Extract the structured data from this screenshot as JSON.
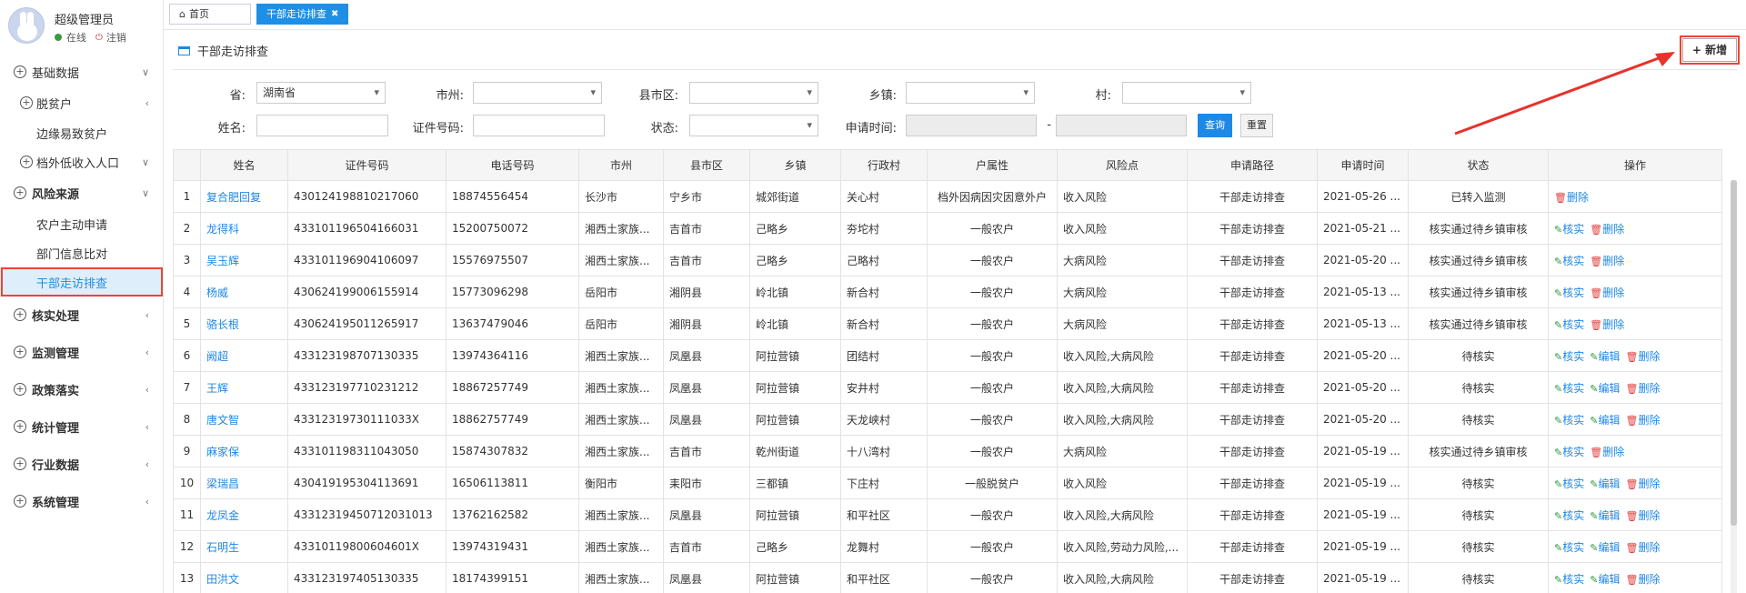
{
  "user": {
    "name": "超级管理员",
    "status": "在线",
    "logout": "注销"
  },
  "sidebar": [
    {
      "label": "基础数据",
      "type": "top",
      "arrow": "∨"
    },
    {
      "label": "脱贫户",
      "type": "sub",
      "arrow": "‹"
    },
    {
      "label": "边缘易致贫户",
      "type": "child"
    },
    {
      "label": "档外低收入人口",
      "type": "sub",
      "arrow": "∨"
    },
    {
      "label": "风险来源",
      "type": "top-bold",
      "arrow": "∨"
    },
    {
      "label": "农户主动申请",
      "type": "child"
    },
    {
      "label": "部门信息比对",
      "type": "child"
    },
    {
      "label": "干部走访排查",
      "type": "child-active"
    },
    {
      "label": "核实处理",
      "type": "top-bold",
      "arrow": "‹"
    },
    {
      "label": "监测管理",
      "type": "top-bold",
      "arrow": "‹"
    },
    {
      "label": "政策落实",
      "type": "top-bold",
      "arrow": "‹"
    },
    {
      "label": "统计管理",
      "type": "top-bold",
      "arrow": "‹"
    },
    {
      "label": "行业数据",
      "type": "top-bold",
      "arrow": "‹"
    },
    {
      "label": "系统管理",
      "type": "top-bold",
      "arrow": "‹"
    }
  ],
  "tabs": {
    "home": "首页",
    "active": "干部走访排查",
    "close": "✖"
  },
  "panel": {
    "title": "干部走访排查",
    "add": "+ 新增"
  },
  "filters": {
    "province_label": "省:",
    "province_value": "湖南省",
    "city_label": "市州:",
    "city_value": "",
    "county_label": "县市区:",
    "county_value": "",
    "town_label": "乡镇:",
    "town_value": "",
    "village_label": "村:",
    "village_value": "",
    "name_label": "姓名:",
    "name_value": "",
    "idno_label": "证件号码:",
    "idno_value": "",
    "status_label": "状态:",
    "status_value": "",
    "date_label": "申请时间:",
    "date_sep": "-",
    "query": "查询",
    "reset": "重置"
  },
  "table": {
    "columns": [
      "",
      "姓名",
      "证件号码",
      "电话号码",
      "市州",
      "县市区",
      "乡镇",
      "行政村",
      "户属性",
      "风险点",
      "申请路径",
      "申请时间",
      "状态",
      "操作"
    ],
    "rows": [
      {
        "n": "1",
        "name": "复合肥回复",
        "id": "430124198810217060",
        "phone": "18874556454",
        "city": "长沙市",
        "county": "宁乡市",
        "town": "城郊街道",
        "village": "关心村",
        "attr": "档外因病因灾因意外户",
        "risk": "收入风险",
        "path": "干部走访排查",
        "date": "2021-05-26 ...",
        "status": "已转入监测",
        "ops": [
          "del"
        ]
      },
      {
        "n": "2",
        "name": "龙得科",
        "id": "433101196504166031",
        "phone": "15200750072",
        "city": "湘西土家族...",
        "county": "吉首市",
        "town": "己略乡",
        "village": "夯坨村",
        "attr": "一般农户",
        "risk": "收入风险",
        "path": "干部走访排查",
        "date": "2021-05-21 ...",
        "status": "核实通过待乡镇审核",
        "ops": [
          "check",
          "del"
        ]
      },
      {
        "n": "3",
        "name": "吴玉辉",
        "id": "433101196904106097",
        "phone": "15576975507",
        "city": "湘西土家族...",
        "county": "吉首市",
        "town": "己略乡",
        "village": "己略村",
        "attr": "一般农户",
        "risk": "大病风险",
        "path": "干部走访排查",
        "date": "2021-05-20 ...",
        "status": "核实通过待乡镇审核",
        "ops": [
          "check",
          "del"
        ]
      },
      {
        "n": "4",
        "name": "杨威",
        "id": "430624199006155914",
        "phone": "15773096298",
        "city": "岳阳市",
        "county": "湘阴县",
        "town": "岭北镇",
        "village": "新合村",
        "attr": "一般农户",
        "risk": "大病风险",
        "path": "干部走访排查",
        "date": "2021-05-13 ...",
        "status": "核实通过待乡镇审核",
        "ops": [
          "check",
          "del"
        ]
      },
      {
        "n": "5",
        "name": "骆长根",
        "id": "430624195011265917",
        "phone": "13637479046",
        "city": "岳阳市",
        "county": "湘阴县",
        "town": "岭北镇",
        "village": "新合村",
        "attr": "一般农户",
        "risk": "大病风险",
        "path": "干部走访排查",
        "date": "2021-05-13 ...",
        "status": "核实通过待乡镇审核",
        "ops": [
          "check",
          "del"
        ]
      },
      {
        "n": "6",
        "name": "阙超",
        "id": "433123198707130335",
        "phone": "13974364116",
        "city": "湘西土家族...",
        "county": "凤凰县",
        "town": "阿拉营镇",
        "village": "团结村",
        "attr": "一般农户",
        "risk": "收入风险,大病风险",
        "path": "干部走访排查",
        "date": "2021-05-20 ...",
        "status": "待核实",
        "ops": [
          "check",
          "edit",
          "del"
        ]
      },
      {
        "n": "7",
        "name": "王辉",
        "id": "433123197710231212",
        "phone": "18867257749",
        "city": "湘西土家族...",
        "county": "凤凰县",
        "town": "阿拉营镇",
        "village": "安井村",
        "attr": "一般农户",
        "risk": "收入风险,大病风险",
        "path": "干部走访排查",
        "date": "2021-05-20 ...",
        "status": "待核实",
        "ops": [
          "check",
          "edit",
          "del"
        ]
      },
      {
        "n": "8",
        "name": "唐文智",
        "id": "43312319730111033X",
        "phone": "18862757749",
        "city": "湘西土家族...",
        "county": "凤凰县",
        "town": "阿拉营镇",
        "village": "天龙峡村",
        "attr": "一般农户",
        "risk": "收入风险,大病风险",
        "path": "干部走访排查",
        "date": "2021-05-20 ...",
        "status": "待核实",
        "ops": [
          "check",
          "edit",
          "del"
        ]
      },
      {
        "n": "9",
        "name": "麻家保",
        "id": "433101198311043050",
        "phone": "15874307832",
        "city": "湘西土家族...",
        "county": "吉首市",
        "town": "乾州街道",
        "village": "十八湾村",
        "attr": "一般农户",
        "risk": "大病风险",
        "path": "干部走访排查",
        "date": "2021-05-19 ...",
        "status": "核实通过待乡镇审核",
        "ops": [
          "check",
          "del"
        ]
      },
      {
        "n": "10",
        "name": "梁瑞昌",
        "id": "430419195304113691",
        "phone": "16506113811",
        "city": "衡阳市",
        "county": "耒阳市",
        "town": "三都镇",
        "village": "下庄村",
        "attr": "一般脱贫户",
        "risk": "收入风险",
        "path": "干部走访排查",
        "date": "2021-05-19 ...",
        "status": "待核实",
        "ops": [
          "check",
          "edit",
          "del"
        ]
      },
      {
        "n": "11",
        "name": "龙凤金",
        "id": "433123194507120310​13",
        "phone": "13762162582",
        "city": "湘西土家族...",
        "county": "凤凰县",
        "town": "阿拉营镇",
        "village": "和平社区",
        "attr": "一般农户",
        "risk": "收入风险,大病风险",
        "path": "干部走访排查",
        "date": "2021-05-19 ...",
        "status": "待核实",
        "ops": [
          "check",
          "edit",
          "del"
        ]
      },
      {
        "n": "12",
        "name": "石明生",
        "id": "43310119800604601X",
        "phone": "13974319431",
        "city": "湘西土家族...",
        "county": "吉首市",
        "town": "己略乡",
        "village": "龙舞村",
        "attr": "一般农户",
        "risk": "收入风险,劳动力风险,...",
        "path": "干部走访排查",
        "date": "2021-05-19 ...",
        "status": "待核实",
        "ops": [
          "check",
          "edit",
          "del"
        ]
      },
      {
        "n": "13",
        "name": "田洪文",
        "id": "433123197405130335",
        "phone": "18174399151",
        "city": "湘西土家族...",
        "county": "凤凰县",
        "town": "阿拉营镇",
        "village": "和平社区",
        "attr": "一般农户",
        "risk": "收入风险,大病风险",
        "path": "干部走访排查",
        "date": "2021-05-19 ...",
        "status": "待核实",
        "ops": [
          "check",
          "edit",
          "del"
        ]
      }
    ],
    "op_labels": {
      "check": "核实",
      "edit": "编辑",
      "del": "删除"
    }
  }
}
